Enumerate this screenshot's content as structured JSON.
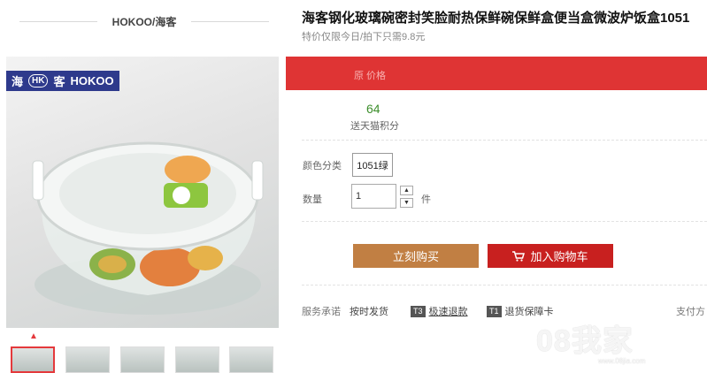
{
  "store": {
    "name": "HOKOO/海客"
  },
  "logo": {
    "text_cn1": "海",
    "text_hk": "HK",
    "text_cn2": "客",
    "text_en": "HOKOO"
  },
  "product": {
    "title": "海客钢化玻璃碗密封笑脸耐热保鲜碗保鲜盒便当盒微波炉饭盒1051",
    "subtitle": "特价仅限今日/拍下只需9.8元"
  },
  "price_banner": {
    "label": "原 价格",
    "color": "#df3434"
  },
  "points": {
    "value": "64",
    "label": "送天猫积分"
  },
  "options": {
    "color_label": "颜色分类",
    "color_value": "1051绿",
    "qty_label": "数量",
    "qty_value": "1",
    "unit": "件"
  },
  "buttons": {
    "buy": "立刻购买",
    "cart": "加入购物车",
    "buy_color": "#c17f43",
    "cart_color": "#c8201f"
  },
  "service": {
    "label": "服务承诺",
    "ship": "按时发货",
    "tag1": "T3",
    "refund": "极速退款",
    "tag2": "T1",
    "card": "退货保障卡",
    "pay": "支付方"
  },
  "watermark": {
    "text": "08我家",
    "sub": "www.08jia.com"
  },
  "icons": {
    "cart": "cart-icon",
    "up": "chevron-up-icon"
  }
}
